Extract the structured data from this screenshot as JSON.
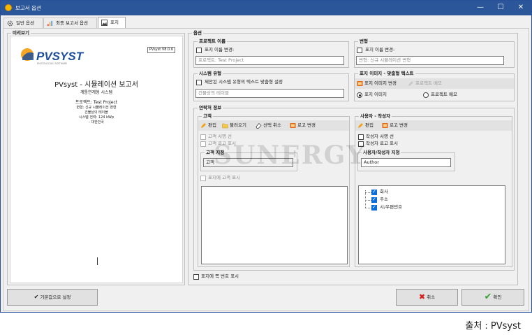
{
  "window": {
    "title": "보고서 옵션",
    "minimize": "—",
    "maximize": "☐",
    "close": "✕"
  },
  "tabs": [
    {
      "label": "일반 옵션",
      "icon": "gear-icon"
    },
    {
      "label": "최종 보고서 옵션",
      "icon": "chart-icon"
    },
    {
      "label": "표지",
      "icon": "image-icon",
      "active": true
    }
  ],
  "preview": {
    "group_label": "미리보기",
    "logo_text": "PVSYST",
    "logo_sub": "PHOTOVOLTAIC SOFTWARE",
    "version": "PVsyst V8.0.6",
    "report_title": "PVsyst - 시뮬레이션 보고서",
    "report_subtitle": "계통연계형 시스템",
    "project_line": "프로젝트: Test Project",
    "variant_line": "변형: 신규 시뮬레이션 변형",
    "building_line": "건물상의 테이블",
    "power_line": "시스템 전력: 124 kWp",
    "country_line": "- 대한민국"
  },
  "options": {
    "group_label": "옵션",
    "project_name": {
      "label": "프로젝트 이름",
      "checkbox": "표지 이름 변경:",
      "placeholder": "프로젝트: Test Project"
    },
    "variant": {
      "label": "변형",
      "checkbox": "표지 이름 변경:",
      "placeholder": "변형: 신규 시뮬레이션 변형"
    },
    "system_type": {
      "label": "시스템 유형",
      "checkbox": "제안된 시스템 유형의 텍스트 맞춤형 설정",
      "placeholder": "건물상의 테이블"
    },
    "cover_image": {
      "label": "표지 이미지 - 맞춤형 텍스트",
      "change_image": "표지 이미지 변경",
      "project_memo_tool": "프로젝트 메모",
      "radio_image": "표지 이미지",
      "radio_memo": "프로젝트 메모"
    },
    "contact": {
      "label": "연락처 정보",
      "client": {
        "label": "고객",
        "edit": "편집",
        "load": "불러오기",
        "deselect": "선택 취소",
        "change_logo": "로고 변경",
        "show_signature": "고객 서명 선",
        "show_logo": "고객 로고 표시",
        "designation_label": "고객 지정",
        "designation_value": "고객",
        "show_on_cover": "표지에 고객 표시"
      },
      "author": {
        "label": "사용자 - 작성자",
        "edit": "편집",
        "change_logo": "로고 변경",
        "show_signature": "작성자 서명 선",
        "show_logo": "작성자 로고 표시",
        "designation_label": "사용자/작성자 지정",
        "designation_value": "Author",
        "tree_items": [
          "회사",
          "주소",
          "시/우편번호"
        ]
      }
    },
    "page_number": "표지에 쪽 번호 표시"
  },
  "buttons": {
    "reset": "기본값으로 설정",
    "cancel": "취소",
    "ok": "확인"
  },
  "watermark": "SUNERGY",
  "caption": "출처 : PVsyst",
  "colors": {
    "titlebar": "#2b579a",
    "accent": "#0a6fd8",
    "cancel_red": "#d9201c",
    "ok_green": "#3aa33a"
  }
}
